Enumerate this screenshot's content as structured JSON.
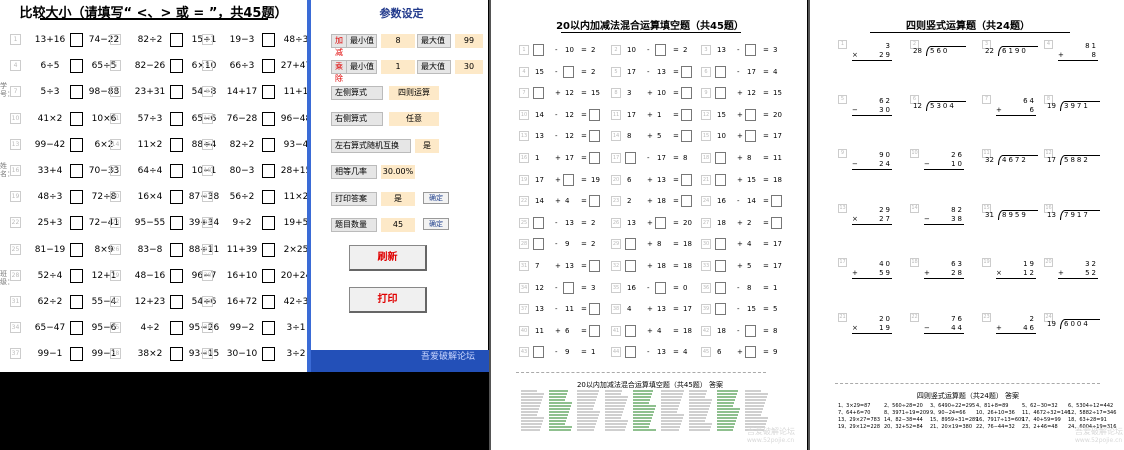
{
  "compare_sheet": {
    "title": "比较大小（请填写“ <、> 或 = ”，共45题）",
    "side_labels": [
      "学号：",
      "姓名：",
      "班级："
    ],
    "rows": [
      [
        [
          "13+16",
          "74−22"
        ],
        [
          "82÷2",
          "15÷1"
        ],
        [
          "19−3",
          "48÷3"
        ]
      ],
      [
        [
          "6÷5",
          "65÷5"
        ],
        [
          "82−26",
          "6×10"
        ],
        [
          "66÷3",
          "27+47"
        ]
      ],
      [
        [
          "5÷3",
          "98−88"
        ],
        [
          "23+31",
          "54−8"
        ],
        [
          "14+17",
          "11+1"
        ]
      ],
      [
        [
          "41×2",
          "10×6"
        ],
        [
          "57÷3",
          "65−6"
        ],
        [
          "76−28",
          "96−48"
        ]
      ],
      [
        [
          "99−42",
          "6×2"
        ],
        [
          "11×2",
          "88÷4"
        ],
        [
          "82÷2",
          "93−4"
        ]
      ],
      [
        [
          "33+4",
          "70−33"
        ],
        [
          "64÷4",
          "10−1"
        ],
        [
          "80−3",
          "28+15"
        ]
      ],
      [
        [
          "48÷3",
          "72÷8"
        ],
        [
          "16×4",
          "87−38"
        ],
        [
          "56÷2",
          "11×2"
        ]
      ],
      [
        [
          "25+3",
          "72−41"
        ],
        [
          "95−55",
          "39+34"
        ],
        [
          "9÷2",
          "19+5"
        ]
      ],
      [
        [
          "81−19",
          "8×9"
        ],
        [
          "83−8",
          "88÷11"
        ],
        [
          "11+39",
          "2×25"
        ]
      ],
      [
        [
          "52÷4",
          "12+1"
        ],
        [
          "48−16",
          "96−7"
        ],
        [
          "16+10",
          "20+24"
        ]
      ],
      [
        [
          "62÷2",
          "55−4"
        ],
        [
          "12+23",
          "54÷6"
        ],
        [
          "16+72",
          "42÷3"
        ]
      ],
      [
        [
          "65−47",
          "95−6"
        ],
        [
          "4÷2",
          "95−26"
        ],
        [
          "99−2",
          "3÷1"
        ]
      ],
      [
        [
          "99−1",
          "99−1"
        ],
        [
          "38×2",
          "93−15"
        ],
        [
          "30−10",
          "3÷2"
        ]
      ]
    ]
  },
  "settings_panel": {
    "title": "参数设定",
    "addsub_label": "加减",
    "muldiv_label": "乘除",
    "min_label": "最小值",
    "max_label": "最大值",
    "addsub_min": "8",
    "addsub_max": "99",
    "muldiv_min": "1",
    "muldiv_max": "30",
    "left_formula_label": "左侧算式",
    "left_formula_value": "四则运算",
    "right_formula_label": "右侧算式",
    "right_formula_value": "任意",
    "swap_label": "左右算式随机互换",
    "swap_value": "是",
    "equal_rate_label": "相等几率",
    "equal_rate_value": "30.00%",
    "print_answer_label": "打印答案",
    "print_answer_value": "是",
    "confirm_label": "确定",
    "question_count_label": "题目数量",
    "question_count_value": "45",
    "refresh_label": "刷新",
    "print_label": "打印",
    "footer_text": "吾爱破解论坛"
  },
  "fill_sheet": {
    "title": "20以内加减法混合运算填空题（共45题）",
    "answer_title": "20以内加减法混合运算填空题（共45题） 答案",
    "rows": [
      [
        [
          "□",
          "-",
          "10",
          "=",
          "2"
        ],
        [
          "10",
          "-",
          "□",
          "=",
          "2"
        ],
        [
          "13",
          "-",
          "□",
          "=",
          "3"
        ]
      ],
      [
        [
          "15",
          "-",
          "□",
          "=",
          "2"
        ],
        [
          "17",
          "-",
          "13",
          "=",
          "□"
        ],
        [
          "□",
          "-",
          "17",
          "=",
          "4"
        ]
      ],
      [
        [
          "□",
          "+",
          "12",
          "=",
          "15"
        ],
        [
          "3",
          "+",
          "10",
          "=",
          "□"
        ],
        [
          "□",
          "+",
          "12",
          "=",
          "15"
        ]
      ],
      [
        [
          "14",
          "-",
          "12",
          "=",
          "□"
        ],
        [
          "17",
          "+",
          "1",
          "=",
          "□"
        ],
        [
          "15",
          "+",
          "□",
          "=",
          "20"
        ]
      ],
      [
        [
          "13",
          "-",
          "12",
          "=",
          "□"
        ],
        [
          "8",
          "+",
          "5",
          "=",
          "□"
        ],
        [
          "10",
          "+",
          "□",
          "=",
          "17"
        ]
      ],
      [
        [
          "1",
          "+",
          "17",
          "=",
          "□"
        ],
        [
          "□",
          "-",
          "17",
          "=",
          "8"
        ],
        [
          "□",
          "+",
          "8",
          "=",
          "11"
        ]
      ],
      [
        [
          "17",
          "+",
          "□",
          "=",
          "19"
        ],
        [
          "6",
          "+",
          "13",
          "=",
          "□"
        ],
        [
          "□",
          "+",
          "15",
          "=",
          "18"
        ]
      ],
      [
        [
          "14",
          "+",
          "4",
          "=",
          "□"
        ],
        [
          "2",
          "+",
          "18",
          "=",
          "□"
        ],
        [
          "16",
          "-",
          "14",
          "=",
          "□"
        ]
      ],
      [
        [
          "□",
          "-",
          "13",
          "=",
          "2"
        ],
        [
          "13",
          "+",
          "□",
          "=",
          "20"
        ],
        [
          "18",
          "+",
          "2",
          "=",
          "□"
        ]
      ],
      [
        [
          "□",
          "-",
          "9",
          "=",
          "2"
        ],
        [
          "□",
          "+",
          "8",
          "=",
          "18"
        ],
        [
          "□",
          "+",
          "4",
          "=",
          "17"
        ]
      ],
      [
        [
          "7",
          "+",
          "13",
          "=",
          "□"
        ],
        [
          "□",
          "+",
          "18",
          "=",
          "18"
        ],
        [
          "□",
          "+",
          "5",
          "=",
          "17"
        ]
      ],
      [
        [
          "12",
          "-",
          "□",
          "=",
          "3"
        ],
        [
          "16",
          "-",
          "□",
          "=",
          "0"
        ],
        [
          "□",
          "-",
          "8",
          "=",
          "1"
        ]
      ],
      [
        [
          "13",
          "-",
          "11",
          "=",
          "□"
        ],
        [
          "4",
          "+",
          "13",
          "=",
          "17"
        ],
        [
          "□",
          "-",
          "15",
          "=",
          "5"
        ]
      ],
      [
        [
          "11",
          "+",
          "6",
          "=",
          "□"
        ],
        [
          "□",
          "+",
          "4",
          "=",
          "18"
        ],
        [
          "18",
          "-",
          "□",
          "=",
          "8"
        ]
      ],
      [
        [
          "□",
          "-",
          "9",
          "=",
          "1"
        ],
        [
          "□",
          "-",
          "13",
          "=",
          "4"
        ],
        [
          "6",
          "+",
          "□",
          "=",
          "9"
        ]
      ]
    ]
  },
  "vertical_sheet": {
    "title": "四则竖式运算题（共24题）",
    "answer_title": "四则竖式运算题（共24题） 答案",
    "rows": [
      [
        {
          "type": "v",
          "a": "3",
          "op": "×",
          "b": "29"
        },
        {
          "type": "d",
          "d": "28",
          "n": "560"
        },
        {
          "type": "d",
          "d": "22",
          "n": "6190"
        },
        {
          "type": "v",
          "a": "81",
          "op": "+",
          "b": "8"
        }
      ],
      [
        {
          "type": "v",
          "a": "62",
          "op": "−",
          "b": "30"
        },
        {
          "type": "d",
          "d": "12",
          "n": "5304"
        },
        {
          "type": "v",
          "a": "64",
          "op": "+",
          "b": "6"
        },
        {
          "type": "d",
          "d": "19",
          "n": "3971"
        }
      ],
      [
        {
          "type": "v",
          "a": "90",
          "op": "−",
          "b": "24"
        },
        {
          "type": "v",
          "a": "26",
          "op": "−",
          "b": "10"
        },
        {
          "type": "d",
          "d": "32",
          "n": "4672"
        },
        {
          "type": "d",
          "d": "17",
          "n": "5882"
        }
      ],
      [
        {
          "type": "v",
          "a": "29",
          "op": "×",
          "b": "27"
        },
        {
          "type": "v",
          "a": "82",
          "op": "−",
          "b": "38"
        },
        {
          "type": "d",
          "d": "31",
          "n": "8959"
        },
        {
          "type": "d",
          "d": "13",
          "n": "7917"
        }
      ],
      [
        {
          "type": "v",
          "a": "40",
          "op": "+",
          "b": "59"
        },
        {
          "type": "v",
          "a": "63",
          "op": "+",
          "b": "28"
        },
        {
          "type": "v",
          "a": "19",
          "op": "×",
          "b": "12"
        },
        {
          "type": "v",
          "a": "32",
          "op": "+",
          "b": "52"
        }
      ],
      [
        {
          "type": "v",
          "a": "20",
          "op": "×",
          "b": "19"
        },
        {
          "type": "v",
          "a": "76",
          "op": "−",
          "b": "44"
        },
        {
          "type": "v",
          "a": "2",
          "op": "+",
          "b": "46"
        },
        {
          "type": "d",
          "d": "19",
          "n": "6004"
        }
      ]
    ],
    "answers": [
      "1、3×29=87",
      "2、560÷28=20",
      "3、6490÷22=295",
      "4、81+8=89",
      "5、62−30=32",
      "6、5304÷12=442",
      "7、64+6=70",
      "8、3971÷19=209",
      "9、90−24=66",
      "10、26+10=36",
      "11、4672÷32=146",
      "12、5882÷17=346",
      "13、29×27=783",
      "14、82−38=44",
      "15、8959÷31=289",
      "16、7917÷13=609",
      "17、40+59=99",
      "18、63+28=91",
      "19、29×12=228",
      "20、32+52=84",
      "21、20×19=380",
      "22、76−44=32",
      "23、2+46=48",
      "24、6004÷19=316"
    ]
  },
  "watermarks": [
    "吾爱破解论坛",
    "www.52pojie.cn"
  ]
}
